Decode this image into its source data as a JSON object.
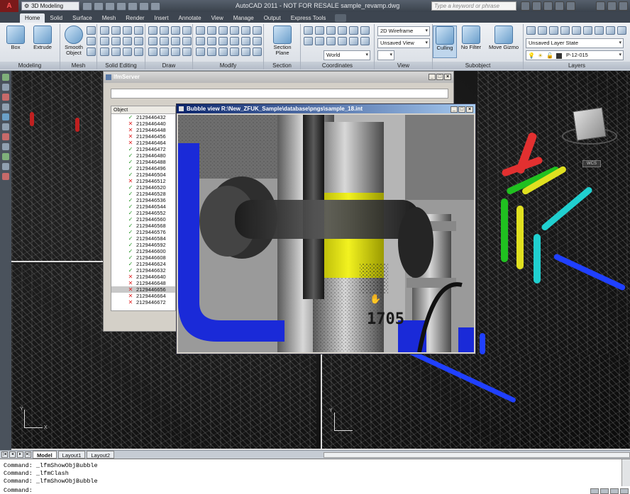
{
  "titlebar": {
    "workspace": "3D Modeling",
    "title": "AutoCAD 2011 - NOT FOR RESALE    sample_revamp.dwg",
    "search_placeholder": "Type a keyword or phrase"
  },
  "tabs": [
    "Home",
    "Solid",
    "Surface",
    "Mesh",
    "Render",
    "Insert",
    "Annotate",
    "View",
    "Manage",
    "Output",
    "Express Tools"
  ],
  "ribbon": {
    "panels": [
      "Modeling",
      "Mesh",
      "Solid Editing",
      "Draw",
      "Modify",
      "Section",
      "Coordinates",
      "View",
      "Subobject",
      "Layers"
    ],
    "buttons": {
      "box": "Box",
      "extrude": "Extrude",
      "smooth_object": "Smooth Object",
      "section_plane": "Section Plane",
      "culling": "Culling",
      "no_filter": "No Filter",
      "move_gizmo": "Move Gizmo"
    },
    "dropdowns": {
      "visual_style": "2D Wireframe",
      "saved_view": "Unsaved View",
      "ucs": "World",
      "layer_state": "Unsaved Layer State",
      "layer": "P-12-015"
    }
  },
  "viewport": {
    "wcs_label": "WCS",
    "ucs_x": "X",
    "ucs_y": "Y"
  },
  "lfm_server": {
    "title": "lfmServer",
    "list_header": "Object",
    "objects": [
      {
        "id": "2129446432",
        "status": "ok"
      },
      {
        "id": "2129446440",
        "status": "bad"
      },
      {
        "id": "2129446448",
        "status": "bad"
      },
      {
        "id": "2129446456",
        "status": "bad"
      },
      {
        "id": "2129446464",
        "status": "bad"
      },
      {
        "id": "2129446472",
        "status": "ok"
      },
      {
        "id": "2129446480",
        "status": "ok"
      },
      {
        "id": "2129446488",
        "status": "ok"
      },
      {
        "id": "2129446496",
        "status": "ok"
      },
      {
        "id": "2129446504",
        "status": "ok"
      },
      {
        "id": "2129446512",
        "status": "bad"
      },
      {
        "id": "2129446520",
        "status": "ok"
      },
      {
        "id": "2129446528",
        "status": "ok"
      },
      {
        "id": "2129446536",
        "status": "ok"
      },
      {
        "id": "2129446544",
        "status": "ok"
      },
      {
        "id": "2129446552",
        "status": "ok"
      },
      {
        "id": "2129446560",
        "status": "ok"
      },
      {
        "id": "2129446568",
        "status": "ok"
      },
      {
        "id": "2129446576",
        "status": "ok"
      },
      {
        "id": "2129446584",
        "status": "ok"
      },
      {
        "id": "2129446592",
        "status": "ok"
      },
      {
        "id": "2129446600",
        "status": "ok"
      },
      {
        "id": "2129446608",
        "status": "ok"
      },
      {
        "id": "2129446624",
        "status": "ok"
      },
      {
        "id": "2129446632",
        "status": "ok"
      },
      {
        "id": "2129446640",
        "status": "bad"
      },
      {
        "id": "2129446648",
        "status": "bad"
      },
      {
        "id": "2129446656",
        "status": "bad",
        "selected": true
      },
      {
        "id": "2129446664",
        "status": "bad"
      },
      {
        "id": "2129446672",
        "status": "bad"
      }
    ],
    "ok_glyph": "✓",
    "bad_glyph": "✕"
  },
  "bubble_view": {
    "title": "Bubble view R:\\New_ZFUK_Sample\\database\\pngs\\sample_18.int",
    "tag_number": "1705"
  },
  "layout_tabs": [
    "Model",
    "Layout1",
    "Layout2"
  ],
  "command_line": {
    "history": [
      "Command: _lfmShowObjBubble",
      "Command: _lfmClash",
      "Command: _lfmShowObjBubble"
    ],
    "prompt": "Command:"
  }
}
